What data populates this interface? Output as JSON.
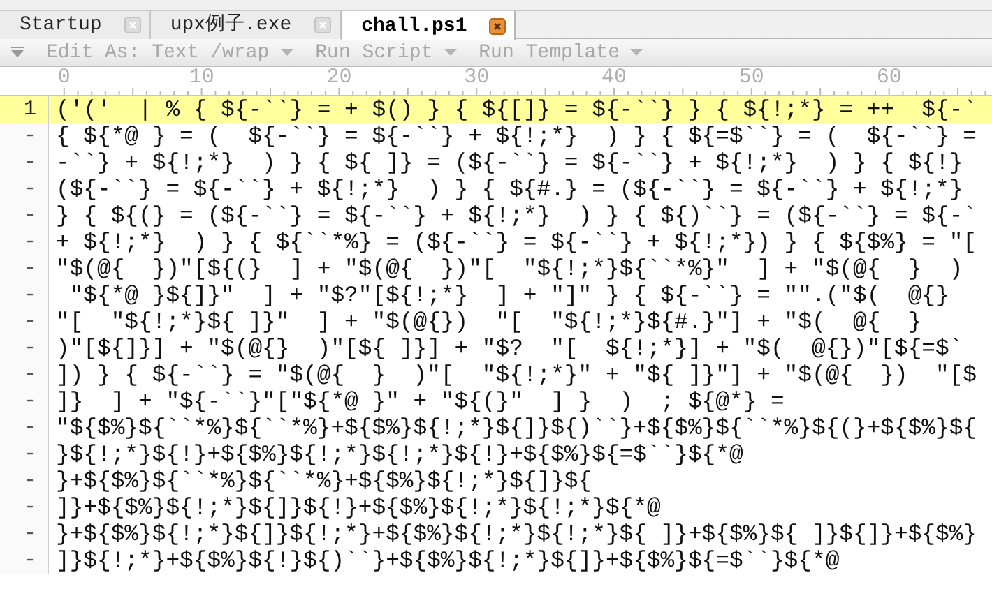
{
  "tabs": [
    {
      "label": "Startup",
      "selected": false
    },
    {
      "label": "upx例子.exe",
      "selected": false
    },
    {
      "label": "chall.ps1",
      "selected": true
    }
  ],
  "toolbar": [
    {
      "label": "Edit As: Text /wrap",
      "disabled": true
    },
    {
      "label": "Run Script",
      "disabled": true
    },
    {
      "label": "Run Template",
      "disabled": true
    }
  ],
  "ruler": [
    "0",
    "10",
    "20",
    "30",
    "40",
    "50",
    "60"
  ],
  "lines": [
    {
      "number": "1",
      "current": true,
      "text": "('('  | % { ${-``} = + $() } { ${[]} = ${-``} } { ${!;*} = ++  ${-`"
    },
    {
      "number": "-",
      "current": false,
      "text": "{ ${*@ } = (  ${-``} = ${-``} + ${!;*}  ) } { ${=$``} = (  ${-``} ="
    },
    {
      "number": "-",
      "current": false,
      "text": "-``} + ${!;*}  ) } { ${ ]} = (${-``} = ${-``} + ${!;*}  ) } { ${!}"
    },
    {
      "number": "-",
      "current": false,
      "text": "(${-``} = ${-``} + ${!;*}  ) } { ${#.} = (${-``} = ${-``} + ${!;*}"
    },
    {
      "number": "-",
      "current": false,
      "text": "} { ${(} = (${-``} = ${-``} + ${!;*}  ) } { ${)``} = (${-``} = ${-`"
    },
    {
      "number": "-",
      "current": false,
      "text": "+ ${!;*}  ) } { ${``*%} = (${-``} = ${-``} + ${!;*}) } { ${$%} = \"["
    },
    {
      "number": "-",
      "current": false,
      "text": "\"$(@{  })\"[${(}  ] + \"$(@{  })\"[  \"${!;*}${``*%}\"  ] + \"$(@{  }  )"
    },
    {
      "number": "-",
      "current": false,
      "text": " \"${*@ }${]}\"  ] + \"$?\"[${!;*}  ] + \"]\" } { ${-``} = \"\".(\"$(  @{}"
    },
    {
      "number": "-",
      "current": false,
      "text": "\"[  \"${!;*}${ ]}\"  ] + \"$(@{})  \"[  \"${!;*}${#.}\"] + \"$(  @{  }"
    },
    {
      "number": "-",
      "current": false,
      "text": ")\"[${]}] + \"$(@{}  )\"[${ ]}] + \"$?  \"[  ${!;*}] + \"$(  @{})\"[${=$`"
    },
    {
      "number": "-",
      "current": false,
      "text": "]) } { ${-``} = \"$(@{  }  )\"[  \"${!;*}\" + \"${ ]}\"] + \"$(@{  })  \"[$"
    },
    {
      "number": "-",
      "current": false,
      "text": "]}  ] + \"${-``}\"[\"${*@ }\" + \"${(}\"  ] }  )  ; ${@*} ="
    },
    {
      "number": "-",
      "current": false,
      "text": "\"${$%}${``*%}${``*%}+${$%}${!;*}${]}${)``}+${$%}${``*%}${(}+${$%}${"
    },
    {
      "number": "-",
      "current": false,
      "text": "}${!;*}${!}+${$%}${!;*}${!;*}${!}+${$%}${=$``}${*@"
    },
    {
      "number": "-",
      "current": false,
      "text": "}+${$%}${``*%}${``*%}+${$%}${!;*}${]}${"
    },
    {
      "number": "-",
      "current": false,
      "text": "]}+${$%}${!;*}${]}${!}+${$%}${!;*}${!;*}${*@"
    },
    {
      "number": "-",
      "current": false,
      "text": "}+${$%}${!;*}${]}${!;*}+${$%}${!;*}${!;*}${ ]}+${$%}${ ]}${]}+${$%}"
    },
    {
      "number": "-",
      "current": false,
      "text": "]}${!;*}+${$%}${!}${)``}+${$%}${!;*}${]}+${$%}${=$``}${*@"
    }
  ]
}
